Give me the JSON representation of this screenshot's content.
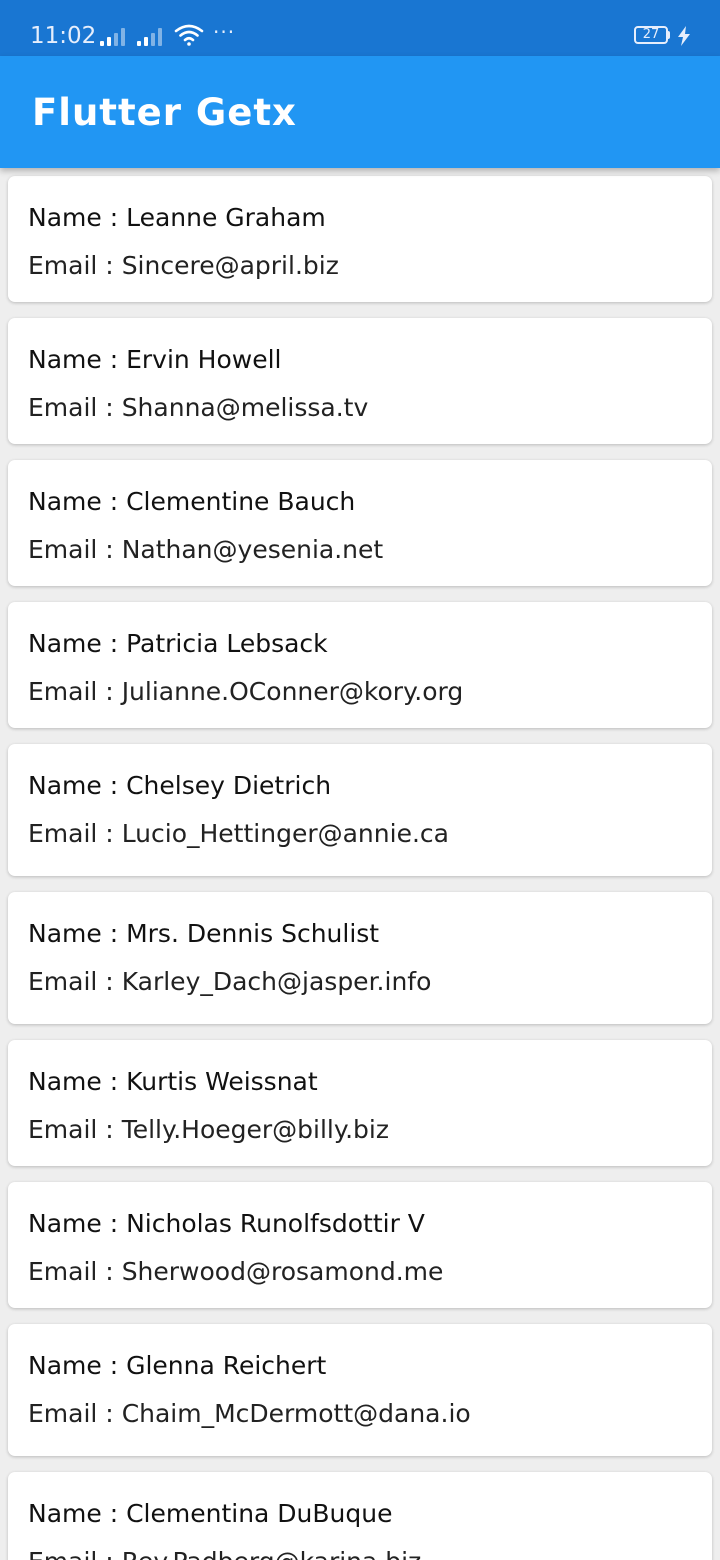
{
  "status_bar": {
    "time": "11:02",
    "more": "···",
    "battery_level": "27"
  },
  "app_bar": {
    "title": "Flutter Getx"
  },
  "labels": {
    "name_prefix": "Name : ",
    "email_prefix": "Email : "
  },
  "users": [
    {
      "name": "Leanne Graham",
      "email": "Sincere@april.biz"
    },
    {
      "name": "Ervin Howell",
      "email": "Shanna@melissa.tv"
    },
    {
      "name": "Clementine Bauch",
      "email": "Nathan@yesenia.net"
    },
    {
      "name": "Patricia Lebsack",
      "email": "Julianne.OConner@kory.org"
    },
    {
      "name": "Chelsey Dietrich",
      "email": "Lucio_Hettinger@annie.ca"
    },
    {
      "name": "Mrs. Dennis Schulist",
      "email": "Karley_Dach@jasper.info"
    },
    {
      "name": "Kurtis Weissnat",
      "email": "Telly.Hoeger@billy.biz"
    },
    {
      "name": "Nicholas Runolfsdottir V",
      "email": "Sherwood@rosamond.me"
    },
    {
      "name": "Glenna Reichert",
      "email": "Chaim_McDermott@dana.io"
    },
    {
      "name": "Clementina DuBuque",
      "email": "Rey.Padberg@karina.biz"
    }
  ],
  "colors": {
    "status_bar": "#1976d2",
    "app_bar": "#2196f3",
    "background": "#eeeeee",
    "card": "#ffffff"
  },
  "icons": {
    "signal_1": "signal-icon",
    "signal_2": "signal-icon",
    "wifi": "wifi-icon",
    "battery": "battery-icon",
    "charging": "charging-bolt-icon"
  }
}
